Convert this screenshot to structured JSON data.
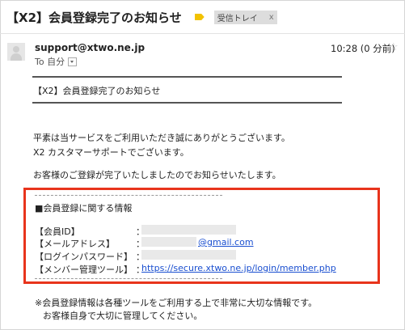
{
  "email": {
    "subject": "【X2】会員登録完了のお知らせ",
    "inbox_label": "受信トレイ",
    "inbox_close": "x",
    "sender": "support@xtwo.ne.jp",
    "to_line": "To 自分",
    "time": "10:28 (0 分前)",
    "star": "☆",
    "inner_title": "【X2】会員登録完了のお知らせ",
    "greeting_1": "平素は当サービスをご利用いただき誠にありがとうございます。",
    "greeting_2": "X2 カスタマーサポートでございます。",
    "notice": "お客様のご登録が完了いたしましたのでお知らせいたします。",
    "section_title": "■会員登録に関する情報",
    "fields": [
      {
        "label": "【会員ID】",
        "colon": "：",
        "value": ""
      },
      {
        "label": "【メールアドレス】",
        "colon": "：",
        "value": "@gmail.com"
      },
      {
        "label": "【ログインパスワード】",
        "colon": "：",
        "value": ""
      },
      {
        "label": "【メンバー管理ツール】",
        "colon": "：",
        "value": "https://secure.xtwo.ne.jp/login/member.php"
      }
    ],
    "footer_1": "※会員登録情報は各種ツールをご利用する上で非常に大切な情報です。",
    "footer_2": "お客様自身で大切に管理してください。"
  },
  "colors": {
    "highlight": "#e8341c",
    "link": "#1a4fd0",
    "label_tag": "#f2c200"
  }
}
